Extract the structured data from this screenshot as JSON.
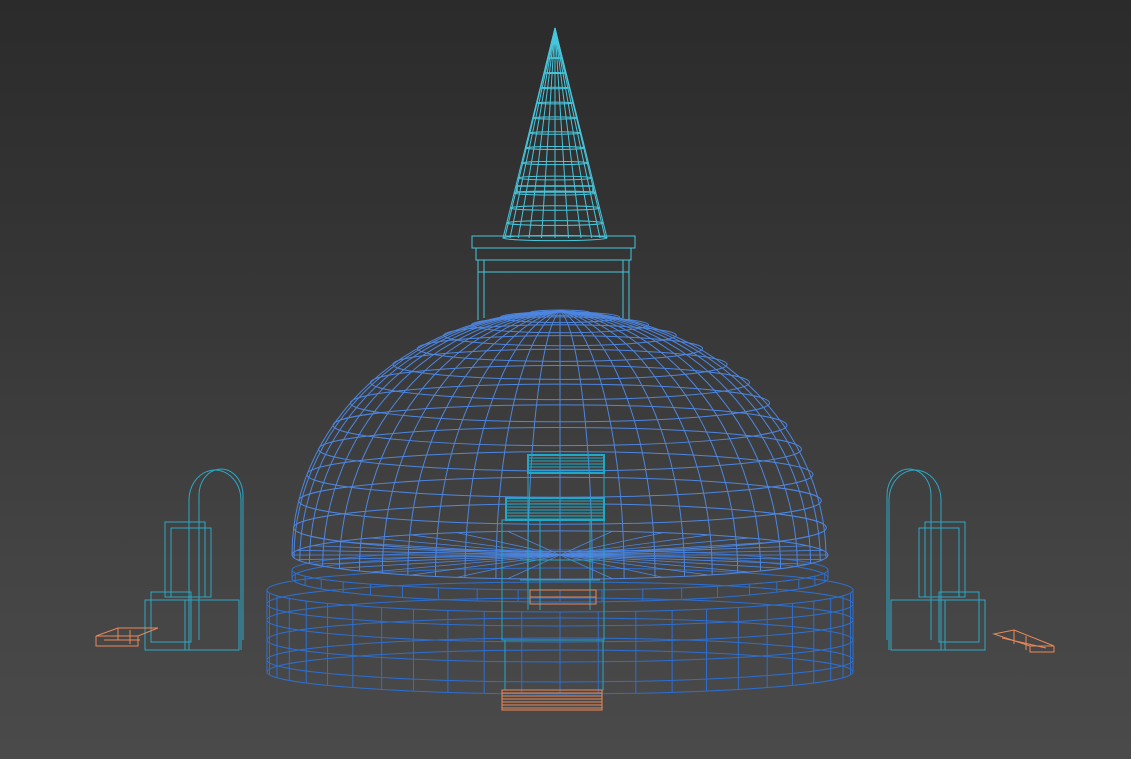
{
  "viewport": {
    "background_top": "#2b2b2b",
    "background_bottom": "#4a4a4a"
  },
  "colors": {
    "spire": "#47c6dc",
    "dome": "#4d86e0",
    "base": "#2d6fd0",
    "stair": "#22a8c4",
    "shrine": "#2ca8c6",
    "step_orange": "#e8885a"
  },
  "objects": [
    {
      "name": "spire",
      "kind": "wire-cone"
    },
    {
      "name": "harmika",
      "kind": "wire-box"
    },
    {
      "name": "dome",
      "kind": "wire-hemisphere"
    },
    {
      "name": "base-drum",
      "kind": "wire-cylinder"
    },
    {
      "name": "stairway",
      "kind": "wire-box"
    },
    {
      "name": "left-shrine",
      "kind": "wire-arch"
    },
    {
      "name": "right-shrine",
      "kind": "wire-arch"
    },
    {
      "name": "entry-steps",
      "kind": "wire-box",
      "selected": true
    },
    {
      "name": "left-steps",
      "kind": "wire-box",
      "selected": true
    },
    {
      "name": "right-steps",
      "kind": "wire-box",
      "selected": true
    }
  ]
}
